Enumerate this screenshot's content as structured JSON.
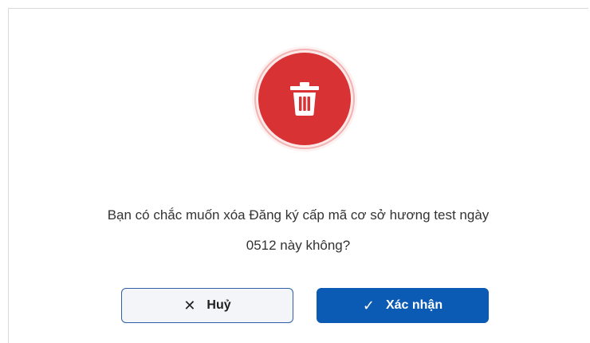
{
  "dialog": {
    "message_line1": "Bạn có chắc muốn xóa Đăng ký cấp mã cơ sở hương test ngày",
    "message_line2": "0512 này không?",
    "icon": "trash-icon",
    "cancel_label": "Huỷ",
    "cancel_icon": "close-icon",
    "confirm_label": "Xác nhận",
    "confirm_icon": "check-icon"
  },
  "colors": {
    "danger": "#d93234",
    "primary": "#0b5ab3",
    "cancel_border": "#2f5fa8",
    "text": "#333333"
  }
}
